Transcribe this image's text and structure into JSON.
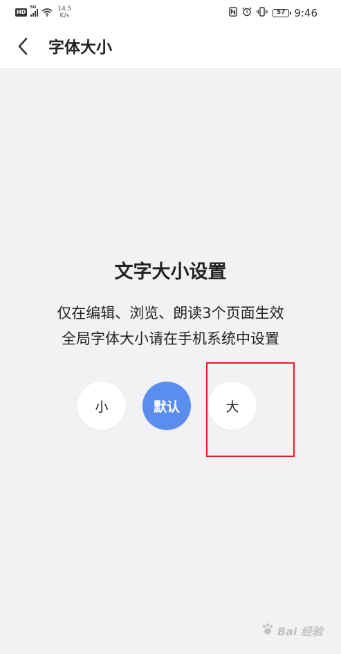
{
  "status_bar": {
    "hd": "HD",
    "network": "5G",
    "speed_value": "14.5",
    "speed_unit": "K/s",
    "battery": "57",
    "time": "9:46"
  },
  "nav": {
    "title": "字体大小"
  },
  "main": {
    "heading": "文字大小设置",
    "desc_line1": "仅在编辑、浏览、朗读3个页面生效",
    "desc_line2": "全局字体大小请在手机系统中设置",
    "options": [
      {
        "label": "小",
        "selected": false
      },
      {
        "label": "默认",
        "selected": true
      },
      {
        "label": "大",
        "selected": false
      }
    ]
  },
  "colors": {
    "accent": "#5b8def",
    "background": "#f2f2f4",
    "highlight": "#e02020"
  },
  "watermark": {
    "text": "Bai 经验",
    "icon": "baidu-paw-icon"
  }
}
